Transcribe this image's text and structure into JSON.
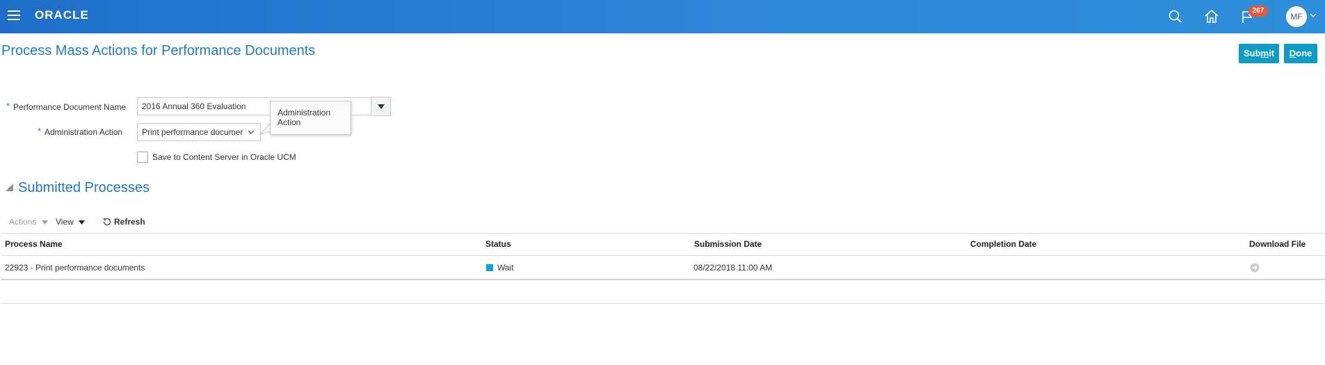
{
  "header": {
    "logo": "ORACLE",
    "notification_count": "267",
    "user_initials": "MF"
  },
  "page": {
    "title": "Process Mass Actions for Performance Documents",
    "submit_label_pre": "Sub",
    "submit_label_mnemonic": "m",
    "submit_label_post": "it",
    "done_label_mnemonic": "D",
    "done_label_post": "one"
  },
  "form": {
    "required_marker": "*",
    "doc_name_label": "Performance Document Name",
    "doc_name_value": "2016 Annual 360 Evaluation",
    "admin_action_label": "Administration Action",
    "admin_action_value": "Print performance documer",
    "tooltip_text": "Administration Action",
    "checkbox_label": "Save to Content Server in Oracle UCM"
  },
  "section": {
    "title": "Submitted Processes"
  },
  "toolbar": {
    "actions_label": "Actions",
    "view_label": "View",
    "refresh_label": "Refresh"
  },
  "table": {
    "columns": [
      "Process Name",
      "Status",
      "Submission Date",
      "Completion Date",
      "Download File"
    ],
    "rows": [
      {
        "process_name": "22923 - Print performance documents",
        "status": "Wait",
        "submission_date": "08/22/2018 11:00 AM",
        "completion_date": "",
        "download_file": "download-icon"
      }
    ]
  },
  "colors": {
    "header_blue": "#2d86d8",
    "title_blue": "#1f7ac4",
    "button_teal": "#0e9cc6",
    "badge_red": "#e8573a",
    "status_wait": "#14a0d6"
  }
}
